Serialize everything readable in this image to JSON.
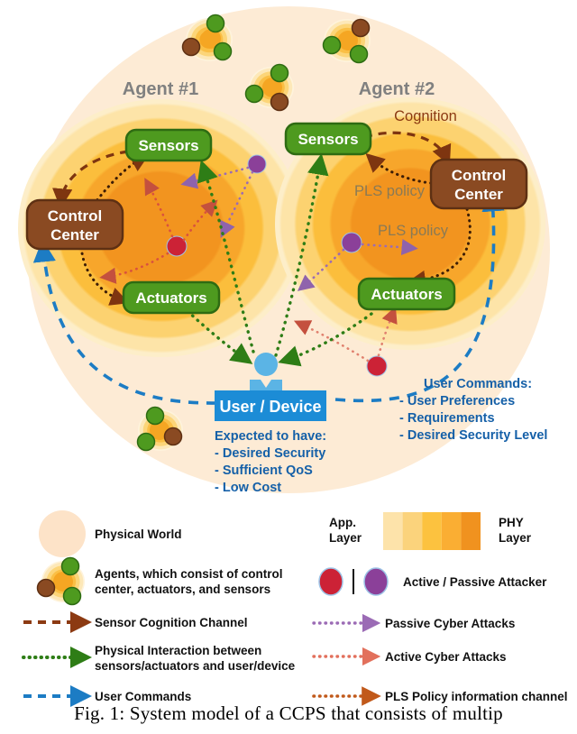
{
  "figure": {
    "caption": "Fig. 1: System model of a CCPS that consists of multip",
    "agents": [
      {
        "label": "Agent #1"
      },
      {
        "label": "Agent #2"
      }
    ],
    "node_labels": {
      "sensors": "Sensors",
      "actuators": "Actuators",
      "control_center_line1": "Control",
      "control_center_line2": "Center",
      "user_device": "User / Device"
    },
    "annotations": {
      "cognition": "Cognition",
      "pls_policy_upper": "PLS policy",
      "pls_policy_lower": "PLS policy"
    },
    "user_expectations": {
      "title": "Expected to have:",
      "items": [
        "- Desired Security",
        "- Sufficient QoS",
        "- Low Cost"
      ]
    },
    "user_commands": {
      "title": "User Commands:",
      "items": [
        "- User Preferences",
        "- Requirements",
        "- Desired Security Level"
      ]
    }
  },
  "legend": {
    "left": [
      {
        "key": "physical-world",
        "icon": "peach-circle",
        "text": "Physical World"
      },
      {
        "key": "agents",
        "icon": "agent-cluster",
        "text_line1": "Agents, which consist of control",
        "text_line2": "center, actuators, and sensors"
      },
      {
        "key": "sensor-cognition",
        "icon": "dashed-arrow",
        "color": "#8C3A12",
        "text": "Sensor Cognition Channel"
      },
      {
        "key": "physical-interaction",
        "icon": "dotted-arrow",
        "color": "#2E7D16",
        "text_line1": "Physical Interaction between",
        "text_line2": "sensors/actuators and user/device"
      },
      {
        "key": "user-commands",
        "icon": "dashed-arrow",
        "color": "#1C7CC4",
        "text": "User Commands"
      }
    ],
    "right": [
      {
        "key": "layer-bar",
        "app_label_line1": "App.",
        "app_label_line2": "Layer",
        "phy_label_line1": "PHY",
        "phy_label_line2": "Layer",
        "bands": [
          "#FDE3AA",
          "#FBD37C",
          "#FCC23F",
          "#FAAE33",
          "#F0921F"
        ]
      },
      {
        "key": "attackers",
        "text": "Active / Passive Attacker",
        "active_color": "#CC2236",
        "passive_color": "#8B4099"
      },
      {
        "key": "passive-cyber-attacks",
        "icon": "dotted-arrow",
        "color": "#9B6BB5",
        "text": "Passive Cyber Attacks"
      },
      {
        "key": "active-cyber-attacks",
        "icon": "dotted-arrow",
        "color": "#E2705C",
        "text": "Active Cyber Attacks"
      },
      {
        "key": "pls-policy-channel",
        "icon": "dotted-arrow",
        "color": "#C1591A",
        "text": "PLS Policy information channel"
      }
    ]
  },
  "colors": {
    "physical_world": "#FDEBD5",
    "node_green": "#4E9A1F",
    "node_brown": "#8A4A22",
    "user_blue": "#1C8CD6",
    "agent_label_gray": "#808080",
    "cognition_brown": "#8C3A12",
    "pls_gray": "#8A7A55",
    "command_text_blue": "#1560A8"
  }
}
